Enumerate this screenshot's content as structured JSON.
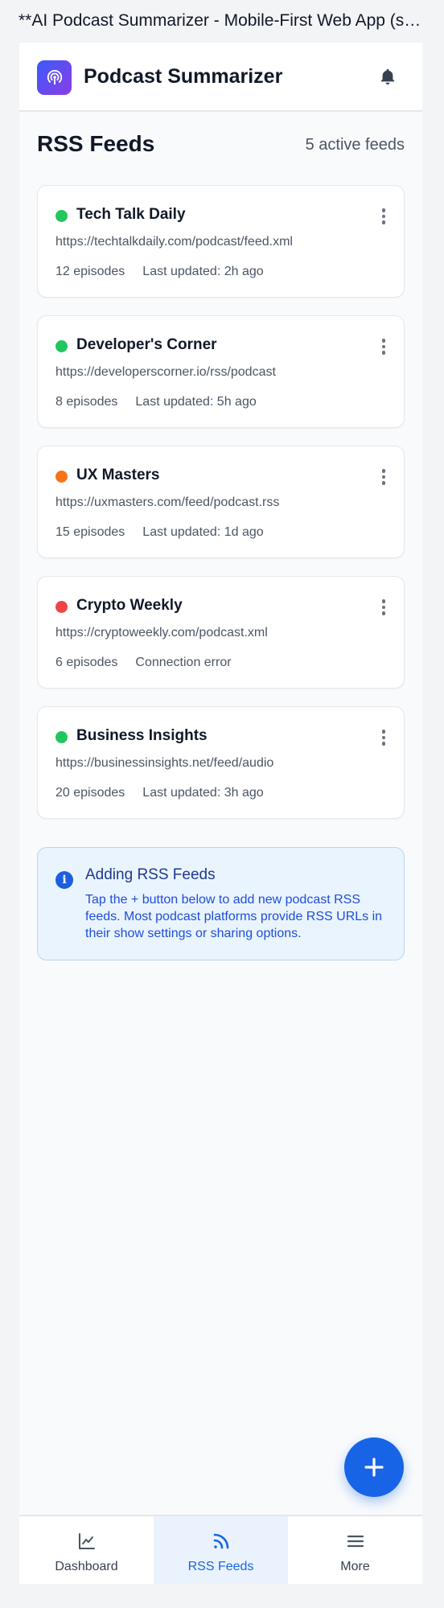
{
  "page": {
    "title": "**AI Podcast Summarizer - Mobile-First Web App (scalable)**"
  },
  "header": {
    "app_name": "Podcast Summarizer",
    "logo_icon": "podcast-icon",
    "notification_icon": "bell-icon"
  },
  "section": {
    "title": "RSS Feeds",
    "active_feeds": "5 active feeds"
  },
  "colors": {
    "active": "#22c55e",
    "warning": "#f97316",
    "error": "#ef4444",
    "accent": "#1765e6"
  },
  "feeds": [
    {
      "name": "Tech Talk Daily",
      "url": "https://techtalkdaily.com/podcast/feed.xml",
      "episodes": "12 episodes",
      "status_text": "Last updated: 2h ago",
      "status": "active"
    },
    {
      "name": "Developer's Corner",
      "url": "https://developerscorner.io/rss/podcast",
      "episodes": "8 episodes",
      "status_text": "Last updated: 5h ago",
      "status": "active"
    },
    {
      "name": "UX Masters",
      "url": "https://uxmasters.com/feed/podcast.rss",
      "episodes": "15 episodes",
      "status_text": "Last updated: 1d ago",
      "status": "warning"
    },
    {
      "name": "Crypto Weekly",
      "url": "https://cryptoweekly.com/podcast.xml",
      "episodes": "6 episodes",
      "status_text": "Connection error",
      "status": "error"
    },
    {
      "name": "Business Insights",
      "url": "https://businessinsights.net/feed/audio",
      "episodes": "20 episodes",
      "status_text": "Last updated: 3h ago",
      "status": "active"
    }
  ],
  "info": {
    "title": "Adding RSS Feeds",
    "text": "Tap the + button below to add new podcast RSS feeds. Most podcast platforms provide RSS URLs in their show settings or sharing options."
  },
  "fab": {
    "icon": "plus-icon"
  },
  "nav": {
    "items": [
      {
        "label": "Dashboard",
        "icon": "chart-line-icon",
        "active": false
      },
      {
        "label": "RSS Feeds",
        "icon": "rss-icon",
        "active": true
      },
      {
        "label": "More",
        "icon": "menu-icon",
        "active": false
      }
    ]
  }
}
